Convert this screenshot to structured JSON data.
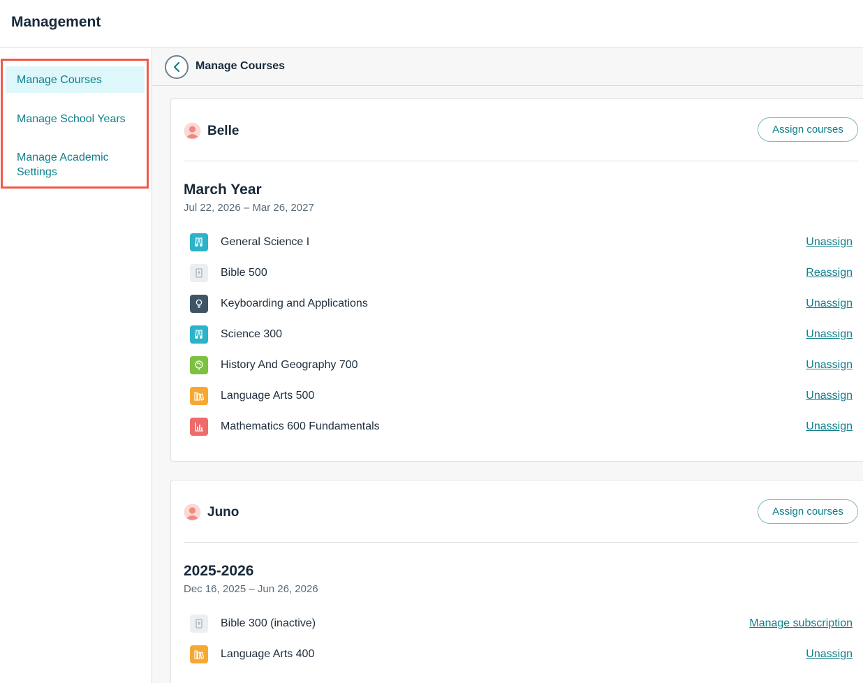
{
  "app": {
    "title": "Management"
  },
  "sidebar": {
    "items": [
      {
        "label": "Manage Courses",
        "active": true
      },
      {
        "label": "Manage School Years",
        "active": false
      },
      {
        "label": "Manage Academic Settings",
        "active": false
      }
    ]
  },
  "subheader": {
    "title": "Manage Courses",
    "back_icon": "chevron-left-icon"
  },
  "students": [
    {
      "name": "Belle",
      "assign_label": "Assign courses",
      "year": {
        "title": "March Year",
        "dates": "Jul 22, 2026 – Mar 26, 2027",
        "courses": [
          {
            "name": "General Science I",
            "action": "Unassign",
            "icon": "science-icon",
            "color": "#2bb3c9"
          },
          {
            "name": "Bible 500",
            "action": "Reassign",
            "icon": "bible-icon",
            "color": "#eceff2"
          },
          {
            "name": "Keyboarding and Applications",
            "action": "Unassign",
            "icon": "lightbulb-icon",
            "color": "#3f5566"
          },
          {
            "name": "Science 300",
            "action": "Unassign",
            "icon": "science-icon",
            "color": "#2bb3c9"
          },
          {
            "name": "History And Geography 700",
            "action": "Unassign",
            "icon": "globe-icon",
            "color": "#7cc142"
          },
          {
            "name": "Language Arts 500",
            "action": "Unassign",
            "icon": "books-icon",
            "color": "#f7a833"
          },
          {
            "name": "Mathematics 600 Fundamentals",
            "action": "Unassign",
            "icon": "math-chart-icon",
            "color": "#ef6b6b"
          }
        ]
      }
    },
    {
      "name": "Juno",
      "assign_label": "Assign courses",
      "year": {
        "title": "2025-2026",
        "dates": "Dec 16, 2025 – Jun 26, 2026",
        "courses": [
          {
            "name": "Bible 300 (inactive)",
            "action": "Manage subscription",
            "icon": "bible-icon",
            "color": "#eceff2"
          },
          {
            "name": "Language Arts 400",
            "action": "Unassign",
            "icon": "books-icon",
            "color": "#f7a833"
          }
        ]
      }
    }
  ],
  "colors": {
    "accent": "#0f7f8a",
    "active_bg": "#def7fa",
    "highlight_frame": "#ef5a4a",
    "avatar": "#f08a80"
  }
}
